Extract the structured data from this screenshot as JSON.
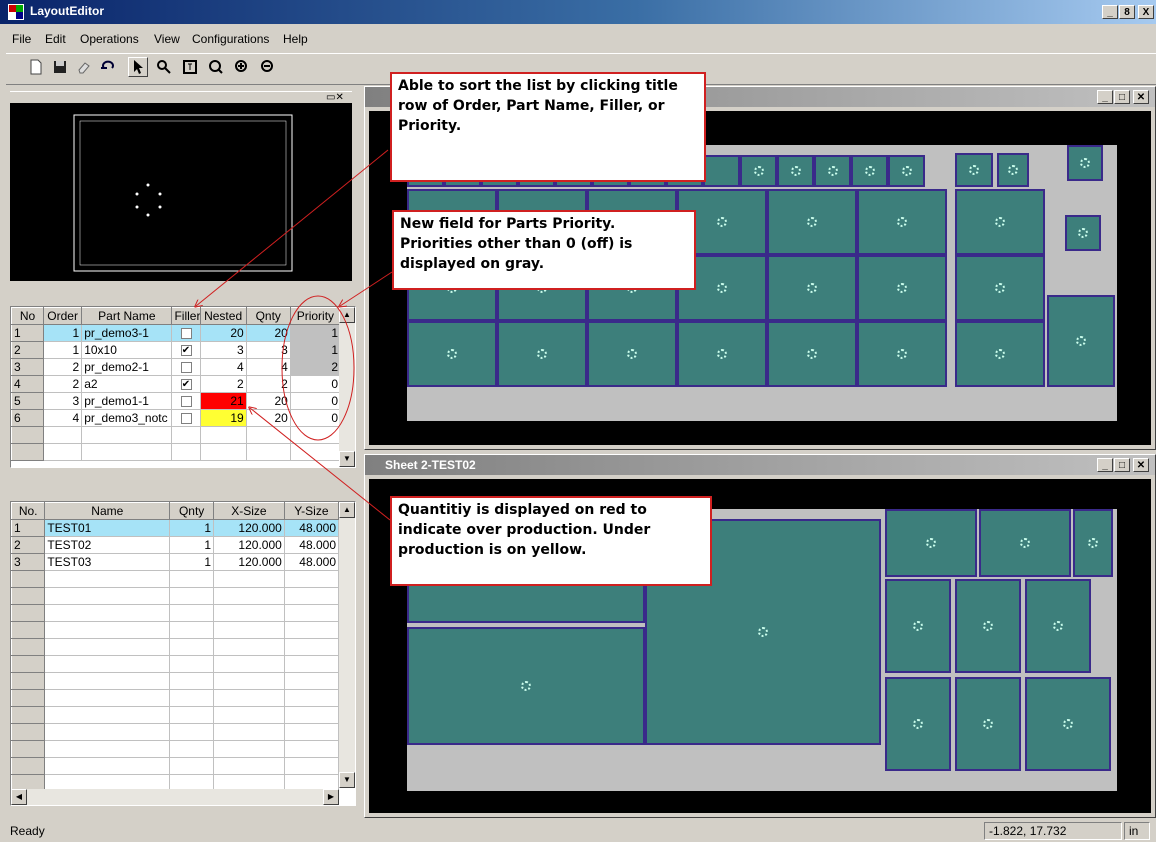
{
  "app": {
    "title": "LayoutEditor",
    "status": "Ready",
    "coords": "-1.822, 17.732",
    "units": "in"
  },
  "menu": [
    "File",
    "Edit",
    "Operations",
    "View",
    "Configurations",
    "Help"
  ],
  "window_buttons": {
    "minimize": "_",
    "restore": "8",
    "close": "X"
  },
  "parts_table": {
    "headers": [
      "No",
      "Order",
      "Part Name",
      "Filler",
      "Nested",
      "Qnty",
      "Priority"
    ],
    "rows": [
      {
        "no": "1",
        "order": "1",
        "name": "pr_demo3-1",
        "filler": false,
        "nested": "20",
        "qnty": "20",
        "priority": "1",
        "nested_status": "ok",
        "priority_gray": true,
        "selected": true
      },
      {
        "no": "2",
        "order": "1",
        "name": "10x10",
        "filler": true,
        "nested": "3",
        "qnty": "3",
        "priority": "1",
        "nested_status": "ok",
        "priority_gray": true,
        "selected": false
      },
      {
        "no": "3",
        "order": "2",
        "name": "pr_demo2-1",
        "filler": false,
        "nested": "4",
        "qnty": "4",
        "priority": "2",
        "nested_status": "ok",
        "priority_gray": true,
        "selected": false
      },
      {
        "no": "4",
        "order": "2",
        "name": "a2",
        "filler": true,
        "nested": "2",
        "qnty": "2",
        "priority": "0",
        "nested_status": "ok",
        "priority_gray": false,
        "selected": false
      },
      {
        "no": "5",
        "order": "3",
        "name": "pr_demo1-1",
        "filler": false,
        "nested": "21",
        "qnty": "20",
        "priority": "0",
        "nested_status": "over",
        "priority_gray": false,
        "selected": false
      },
      {
        "no": "6",
        "order": "4",
        "name": "pr_demo3_notc",
        "filler": false,
        "nested": "19",
        "qnty": "20",
        "priority": "0",
        "nested_status": "under",
        "priority_gray": false,
        "selected": false
      }
    ],
    "colors": {
      "over": "#ff0000",
      "under": "#ffff33",
      "selected": "#a6e3f7",
      "gray": "#c0c0c0"
    }
  },
  "sheets_table": {
    "headers": [
      "No.",
      "Name",
      "Qnty",
      "X-Size",
      "Y-Size"
    ],
    "rows": [
      {
        "no": "1",
        "name": "TEST01",
        "qnty": "1",
        "x": "120.000",
        "y": "48.000",
        "selected": true
      },
      {
        "no": "2",
        "name": "TEST02",
        "qnty": "1",
        "x": "120.000",
        "y": "48.000",
        "selected": false
      },
      {
        "no": "3",
        "name": "TEST03",
        "qnty": "1",
        "x": "120.000",
        "y": "48.000",
        "selected": false
      }
    ]
  },
  "sheet_windows": {
    "second_title": "Sheet 2-TEST02"
  },
  "annotations": {
    "sort": "Able to sort the list by clicking title row of Order, Part Name, Filler, or Priority.",
    "priority": "New field for Parts Priority. Priorities other than 0 (off) is displayed on gray.",
    "quantity": "Quantitiy is displayed on red to indicate over production. Under production is on yellow."
  }
}
